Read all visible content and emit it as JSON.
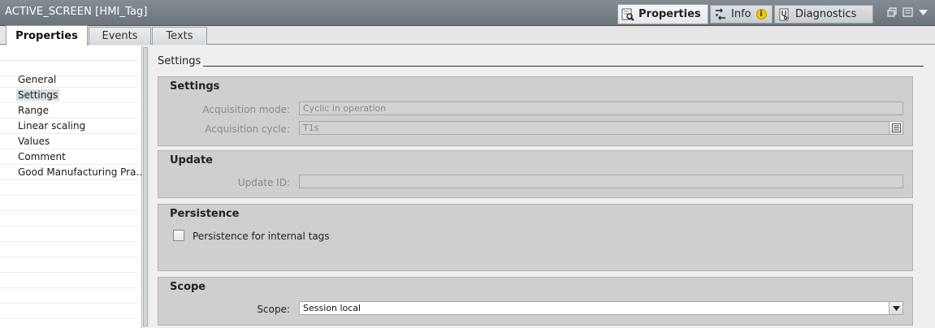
{
  "window": {
    "title": "ACTIVE_SCREEN [HMI_Tag]"
  },
  "panel_tabs": [
    {
      "label": "Properties",
      "icon": "properties-magnifier-icon",
      "active": true
    },
    {
      "label": "Info",
      "icon": "info-arrows-icon",
      "badge_icon": "warning-info-icon",
      "badge_text": "i"
    },
    {
      "label": "Diagnostics",
      "icon": "diagnostics-stethoscope-icon"
    }
  ],
  "window_controls": [
    "restore-icon",
    "list-icon",
    "collapse-arrow-icon"
  ],
  "subtabs": [
    {
      "label": "Properties",
      "active": true
    },
    {
      "label": "Events"
    },
    {
      "label": "Texts"
    }
  ],
  "nav": {
    "items": [
      {
        "label": "General"
      },
      {
        "label": "Settings",
        "selected": true
      },
      {
        "label": "Range"
      },
      {
        "label": "Linear scaling"
      },
      {
        "label": "Values"
      },
      {
        "label": "Comment"
      },
      {
        "label": "Good Manufacturing Pra..."
      }
    ]
  },
  "content": {
    "heading": "Settings",
    "settings_group": {
      "title": "Settings",
      "acquisition_mode_label": "Acquisition mode:",
      "acquisition_mode_value": "Cyclic in operation",
      "acquisition_cycle_label": "Acquisition cycle:",
      "acquisition_cycle_value": "T1s"
    },
    "update_group": {
      "title": "Update",
      "update_id_label": "Update ID:",
      "update_id_value": ""
    },
    "persistence_group": {
      "title": "Persistence",
      "persistence_label": "Persistence for internal tags",
      "persistence_checked": false
    },
    "scope_group": {
      "title": "Scope",
      "scope_label": "Scope:",
      "scope_value": "Session local"
    }
  },
  "colors": {
    "titlebar": "#7a838b",
    "group_background": "#cfcfcf",
    "selected_nav": "#d9dde1"
  }
}
